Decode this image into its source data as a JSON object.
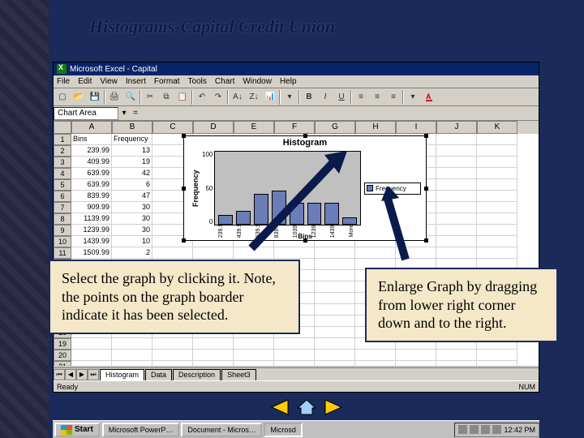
{
  "slide": {
    "title": "Histograms-Capital Credit Union"
  },
  "excel": {
    "app_title": "Microsoft Excel - Capital",
    "menus": [
      "File",
      "Edit",
      "View",
      "Insert",
      "Format",
      "Tools",
      "Chart",
      "Window",
      "Help"
    ],
    "name_box": "Chart Area",
    "fx_symbol": "=",
    "columns": [
      "A",
      "B",
      "C",
      "D",
      "E",
      "F",
      "G",
      "H",
      "I",
      "J",
      "K"
    ],
    "headers": {
      "A": "Bins",
      "B": "Frequency"
    },
    "rows": [
      {
        "n": 1,
        "A": "Bins",
        "B": "Frequency"
      },
      {
        "n": 2,
        "A": "239.99",
        "B": "13"
      },
      {
        "n": 3,
        "A": "409.99",
        "B": "19"
      },
      {
        "n": 4,
        "A": "639.99",
        "B": "42"
      },
      {
        "n": 5,
        "A": "639.99",
        "B": "6"
      },
      {
        "n": 6,
        "A": "839.99",
        "B": "47"
      },
      {
        "n": 7,
        "A": "909.99",
        "B": "30"
      },
      {
        "n": 8,
        "A": "1139.99",
        "B": "30"
      },
      {
        "n": 9,
        "A": "1239.99",
        "B": "30"
      },
      {
        "n": 10,
        "A": "1439.99",
        "B": "10"
      },
      {
        "n": 11,
        "A": "1509.99",
        "B": "2"
      }
    ],
    "sheet_tabs": [
      "Histogram",
      "Data",
      "Description",
      "Sheet3"
    ],
    "status": "Ready",
    "num_indicator": "NUM"
  },
  "chart_data": {
    "type": "bar",
    "title": "Histogram",
    "xlabel": "Bins",
    "ylabel": "Frequency",
    "legend": "Frequency",
    "y_ticks": [
      "100",
      "50",
      "0"
    ],
    "categories": [
      "239.9",
      "439.9",
      "639.9",
      "839.9",
      "1039.",
      "1239.",
      "1439.",
      "More"
    ],
    "values": [
      13,
      19,
      42,
      47,
      30,
      30,
      30,
      10
    ],
    "ylim": [
      0,
      100
    ]
  },
  "callouts": {
    "left": "Select the graph by clicking it. Note, the points on the graph boarder indicate it has been selected.",
    "right": "Enlarge Graph by dragging from lower right corner down and to the right."
  },
  "taskbar": {
    "start": "Start",
    "items": [
      "Microsoft PowerP…",
      "Document - Micros…",
      "Microsd"
    ],
    "clock": "12:42 PM"
  },
  "fmt": {
    "B": "B",
    "I": "I",
    "U": "U",
    "A": "A"
  }
}
